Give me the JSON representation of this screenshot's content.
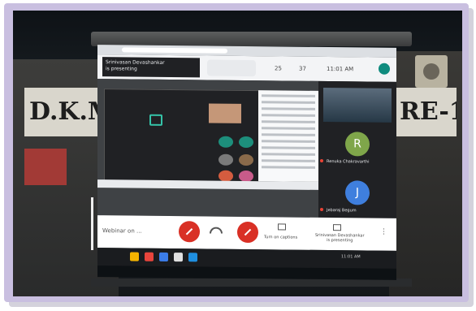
{
  "banners": {
    "left_text": "D.K.M",
    "right_text": "RE-1."
  },
  "meet": {
    "presenter_name": "Srinivasan Devashankar",
    "presenter_status": "is presenting",
    "top_chip_text": "",
    "top_numbers": [
      "25",
      "37"
    ],
    "clock": "11:01 AM",
    "main_title": "",
    "shared_screen_text": "",
    "participants": [
      {
        "initial": "R",
        "name": "Renuka Chakravarthi",
        "color": "#7fa64a"
      },
      {
        "initial": "J",
        "name": "Jebaraj Begum",
        "color": "#3f7fde"
      }
    ],
    "meeting_title": "Webinar on ...",
    "captions_label": "Turn on captions",
    "presenting_label_line1": "Srinivasan Devashankar",
    "presenting_label_line2": "is presenting",
    "more_label": "⋮"
  },
  "taskbar": {
    "tray_time": "11:01 AM",
    "tray_date": "",
    "icon_colors": [
      "#f5b400",
      "#e8453c",
      "#3b7de9",
      "#e0e0e0",
      "#1f8fe0"
    ]
  }
}
